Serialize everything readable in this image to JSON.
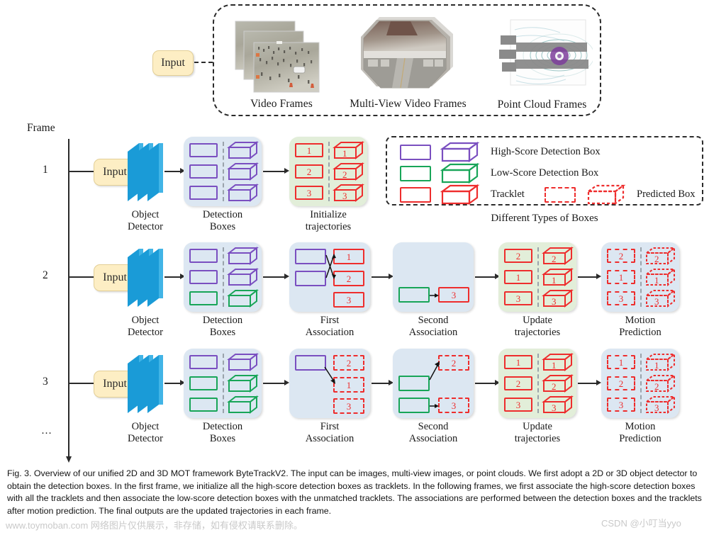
{
  "figure": {
    "caption": "Fig. 3. Overview of our unified 2D and 3D MOT framework ByteTrackV2. The input can be images, multi-view images, or point clouds. We first adopt a 2D or 3D object detector to obtain the detection boxes. In the first frame, we initialize all the high-score detection boxes as tracklets. In the following frames, we first associate the high-score detection boxes with all the tracklets and then associate the low-score detection boxes with the unmatched tracklets. The associations are performed between the detection boxes and the tracklets after motion prediction. The final outputs are the updated trajectories in each frame."
  },
  "watermarks": {
    "left": "www.toymoban.com 网络图片仅供展示，非存储，如有侵权请联系删除。",
    "right": "CSDN @小叮当yyo"
  },
  "input_source": {
    "input_label": "Input",
    "items": [
      {
        "caption": "Video Frames",
        "icon": "video-frames-stack"
      },
      {
        "caption": "Multi-View Video Frames",
        "icon": "multiview-frames-stack"
      },
      {
        "caption": "Point Cloud Frames",
        "icon": "point-cloud-frames-stack"
      }
    ]
  },
  "axis": {
    "title": "Frame",
    "ticks": [
      "1",
      "2",
      "3",
      "…"
    ]
  },
  "colors": {
    "high_score": "#7a4fc0",
    "low_score": "#18a558",
    "tracklet": "#ee2d2d",
    "panel_blue": "#dce7f2",
    "panel_green": "#e2eed9",
    "input_fill": "#fdeec4",
    "detector_blue": "#1a9bd7"
  },
  "legend": {
    "title": "Different Types of Boxes",
    "rows": [
      {
        "label": "High-Score Detection Box",
        "color": "#7a4fc0"
      },
      {
        "label": "Low-Score Detection Box",
        "color": "#18a558"
      },
      {
        "label": "Tracklet",
        "color": "#ee2d2d",
        "extra_label": "Predicted Box"
      }
    ]
  },
  "stages": {
    "input": "Input",
    "detector": "Object\nDetector",
    "detection_boxes": "Detection\nBoxes",
    "initialize": "Initialize\ntrajectories",
    "first_association": "First\nAssociation",
    "second_association": "Second\nAssociation",
    "update": "Update\ntrajectories",
    "motion_prediction": "Motion\nPrediction"
  },
  "rows": [
    {
      "frame": "1",
      "detection_boxes": {
        "colors_2d": [
          "purple",
          "purple",
          "purple"
        ],
        "colors_3d": [
          "purple",
          "purple",
          "purple"
        ]
      },
      "initialize": {
        "ids_2d": [
          "1",
          "2",
          "3"
        ],
        "ids_3d": [
          "1",
          "2",
          "3"
        ]
      }
    },
    {
      "frame": "2",
      "detection_boxes": {
        "colors_2d": [
          "purple",
          "purple",
          "green"
        ],
        "colors_3d": [
          "purple",
          "purple",
          "green"
        ]
      },
      "first_association": {
        "detections": [
          "purple",
          "purple"
        ],
        "tracklets": [
          "1",
          "2",
          "3"
        ],
        "links": "crossed"
      },
      "second_association": {
        "detection": "green",
        "tracklet": "3"
      },
      "update": {
        "ids_2d": [
          "2",
          "1",
          "3"
        ],
        "ids_3d": [
          "2",
          "1",
          "3"
        ]
      },
      "motion_prediction": {
        "ids_2d": [
          "2",
          "1",
          "3"
        ],
        "ids_3d": [
          "2",
          "1",
          "3"
        ]
      }
    },
    {
      "frame": "3",
      "detection_boxes": {
        "colors_2d": [
          "purple",
          "green",
          "green"
        ],
        "colors_3d": [
          "purple",
          "green",
          "green"
        ]
      },
      "first_association": {
        "detections": [
          "purple"
        ],
        "tracklets": [
          "2",
          "1",
          "3"
        ],
        "links": "single"
      },
      "second_association": {
        "detections": [
          "green",
          "green"
        ],
        "tracklets": [
          "2",
          "3"
        ]
      },
      "update": {
        "ids_2d": [
          "1",
          "2",
          "3"
        ],
        "ids_3d": [
          "1",
          "2",
          "3"
        ]
      },
      "motion_prediction": {
        "ids_2d": [
          "1",
          "2",
          "3"
        ],
        "ids_3d": [
          "1",
          "2",
          "3"
        ]
      }
    }
  ]
}
